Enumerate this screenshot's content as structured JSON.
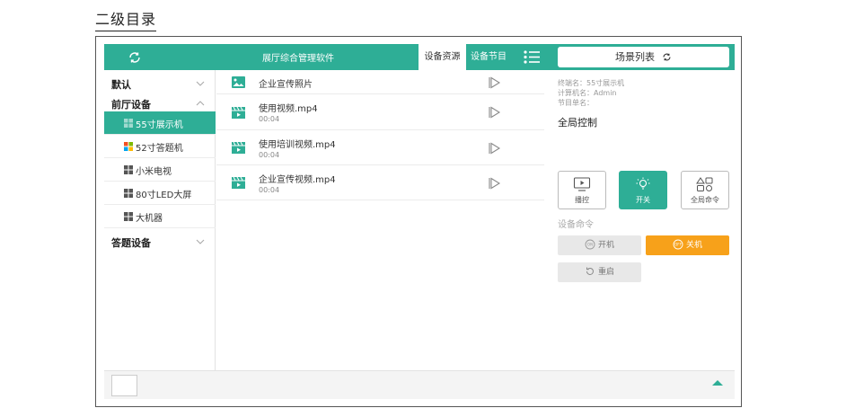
{
  "page_heading": "二级目录",
  "topbar": {
    "refresh_icon": "refresh-icon",
    "title": "展厅综合管理软件",
    "tabs": [
      {
        "label": "设备资源",
        "active": true
      },
      {
        "label": "设备节目",
        "active": false
      }
    ],
    "menu_icon": "list-menu-icon",
    "scene_button": {
      "label": "场景列表",
      "icon": "refresh-icon"
    }
  },
  "sidebar": {
    "groups": [
      {
        "label": "默认",
        "expanded": false
      },
      {
        "label": "前厅设备",
        "expanded": true
      },
      {
        "label": "答题设备",
        "expanded": false
      }
    ],
    "devices": [
      {
        "label": "55寸展示机",
        "active": true
      },
      {
        "label": "52寸答题机",
        "active": false
      },
      {
        "label": "小米电视",
        "active": false
      },
      {
        "label": "80寸LED大屏",
        "active": false
      },
      {
        "label": "大机器",
        "active": false
      }
    ]
  },
  "files": [
    {
      "name": "企业宣传照片",
      "type": "image",
      "duration": ""
    },
    {
      "name": "使用视频.mp4",
      "type": "video",
      "duration": "00:04"
    },
    {
      "name": "使用培训视频.mp4",
      "type": "video",
      "duration": "00:04"
    },
    {
      "name": "企业宣传视频.mp4",
      "type": "video",
      "duration": "00:04"
    }
  ],
  "right_panel": {
    "terminal": "终端名：55寸展示机",
    "computer": "计算机名：Admin",
    "program": "节目单名：",
    "global_control_title": "全局控制",
    "controls": [
      {
        "label": "播控",
        "icon": "monitor-play-icon",
        "active": false
      },
      {
        "label": "开关",
        "icon": "lightbulb-icon",
        "active": true
      },
      {
        "label": "全局命令",
        "icon": "shapes-icon",
        "active": false
      }
    ],
    "device_command_title": "设备命令",
    "commands": [
      {
        "label": "开机",
        "icon": "power-on-icon",
        "style": "grey"
      },
      {
        "label": "关机",
        "icon": "power-off-icon",
        "style": "orange"
      },
      {
        "label": "重启",
        "icon": "restart-icon",
        "style": "grey"
      }
    ]
  },
  "colors": {
    "accent": "#2eae96",
    "orange": "#f7a11a"
  }
}
